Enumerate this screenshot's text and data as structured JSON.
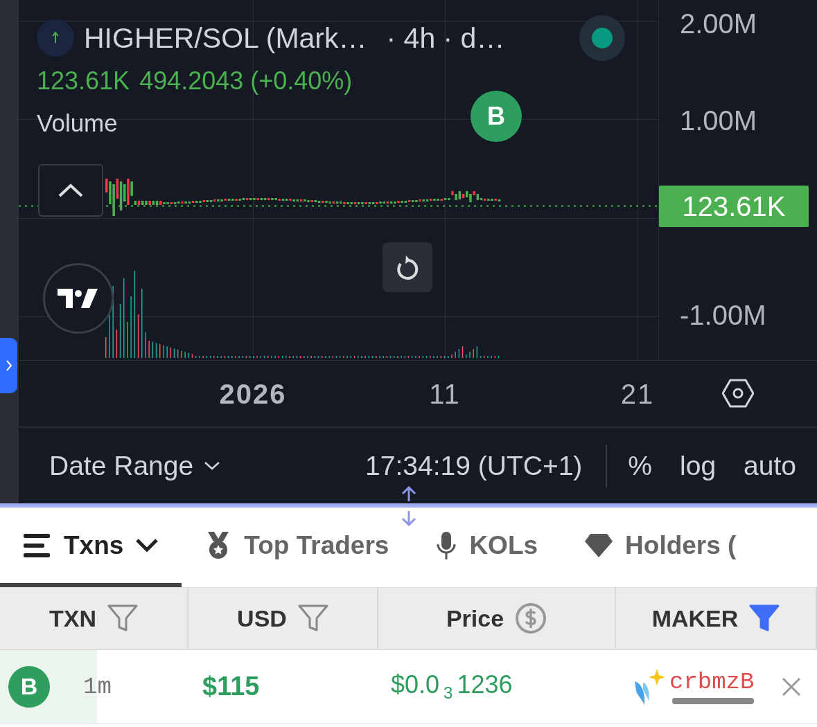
{
  "legend": {
    "symbol": "HIGHER/SOL (Mark…",
    "interval": "· 4h · d…",
    "value": "123.61K",
    "price": "494.2043 (+0.40%)",
    "indicator": "Volume"
  },
  "marker": {
    "label": "B"
  },
  "price_axis": {
    "labels": [
      "2.00M",
      "1.00M",
      "-1.00M"
    ],
    "current": "123.61K"
  },
  "time_axis": [
    {
      "label": "2026",
      "kind": "year"
    },
    {
      "label": "11",
      "kind": "day"
    },
    {
      "label": "21",
      "kind": "day"
    }
  ],
  "toolbar": {
    "date_range": "Date Range",
    "time": "17:34:19 (UTC+1)",
    "options": [
      "%",
      "log",
      "auto"
    ]
  },
  "tabs": [
    {
      "label": "Txns",
      "kind": "menu",
      "selected": true
    },
    {
      "label": "Top Traders",
      "kind": "medal",
      "selected": false
    },
    {
      "label": "KOLs",
      "kind": "mic",
      "selected": false
    },
    {
      "label": "Holders (",
      "kind": "diamond",
      "selected": false
    }
  ],
  "table": {
    "columns": [
      {
        "label": "TXN",
        "kind": "filter",
        "active": false
      },
      {
        "label": "USD",
        "kind": "filter",
        "active": false
      },
      {
        "label": "Price",
        "kind": "dollar",
        "active": false
      },
      {
        "label": "MAKER",
        "kind": "filter",
        "active": true
      }
    ],
    "rows": [
      {
        "type": "B",
        "age": "1m",
        "usd": "$115",
        "price": "$0.0$_{3}$1236",
        "maker": "crbmzB"
      }
    ]
  }
}
